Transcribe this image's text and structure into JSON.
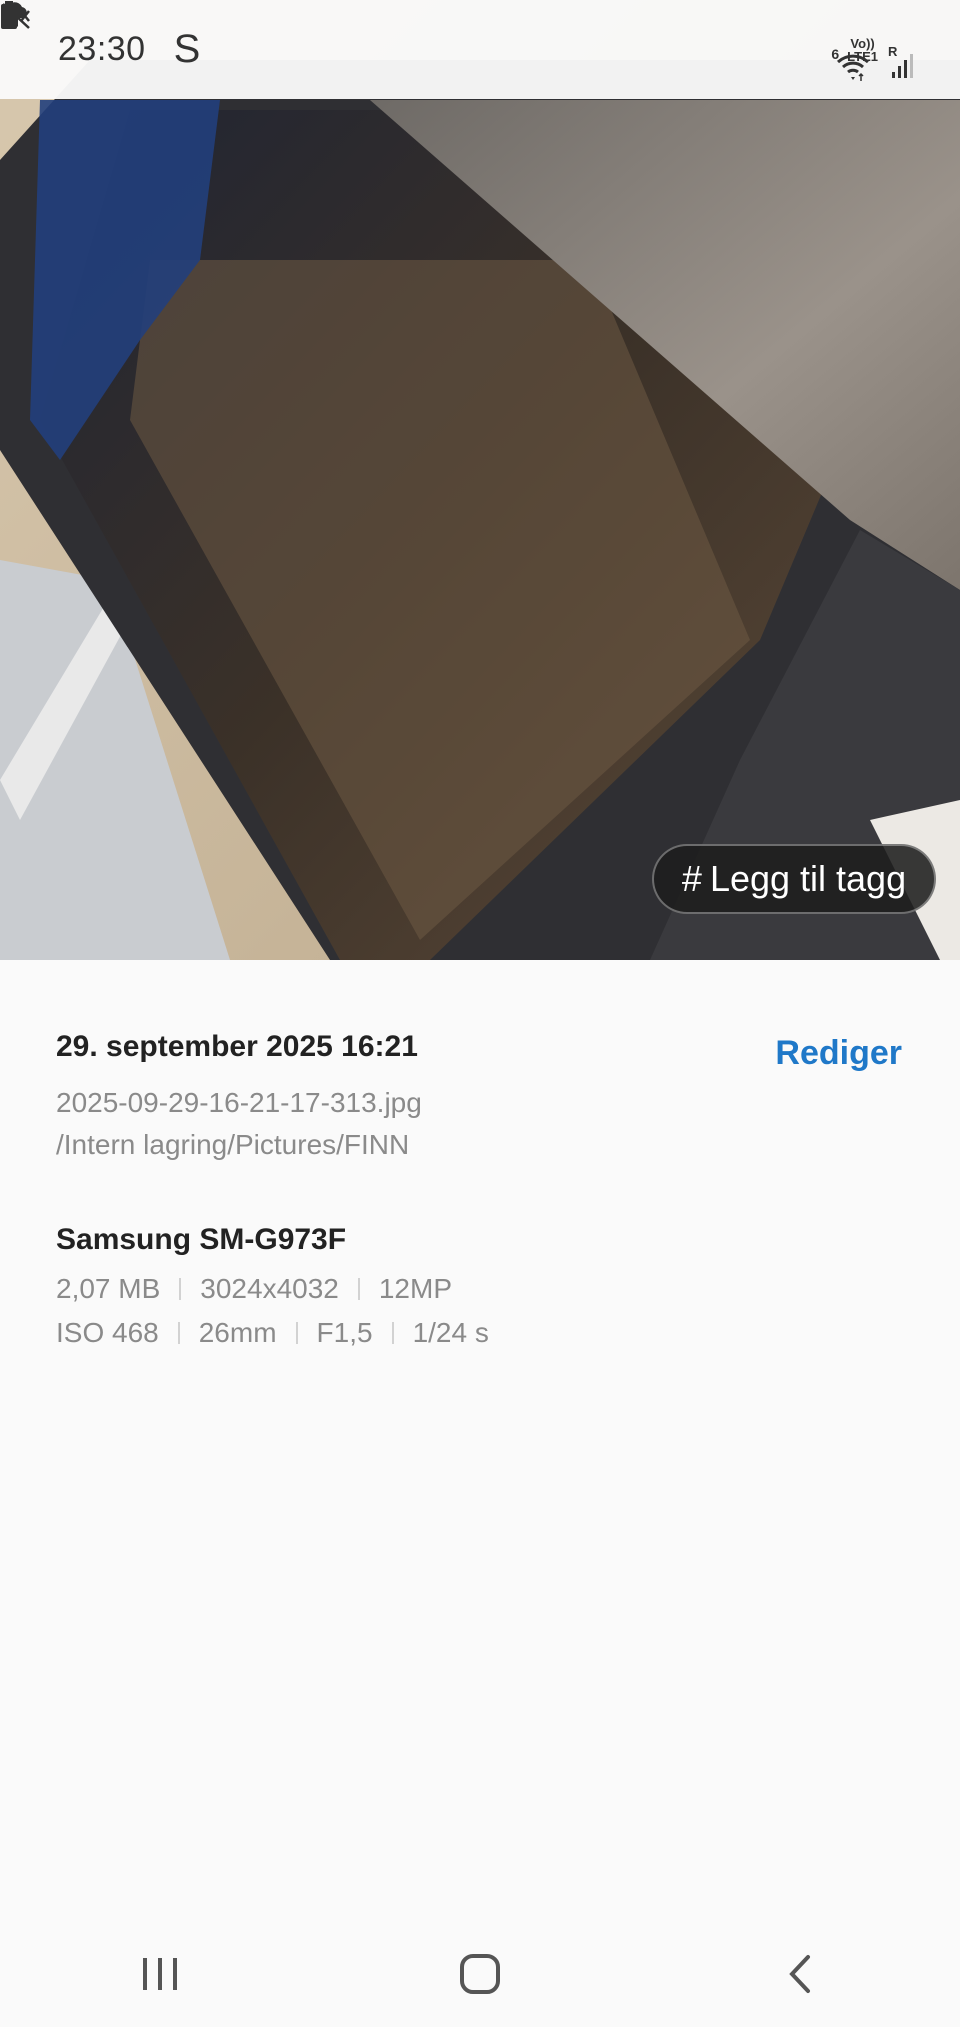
{
  "status_bar": {
    "time": "23:30",
    "app_letter": "S",
    "icons": [
      "cloud-icon",
      "mute-icon",
      "wifi-icon",
      "volte-lte-icon",
      "signal-icon",
      "battery-icon"
    ],
    "wifi_badge": "6",
    "volte_label": "Vo))",
    "lte_label": "LTE1",
    "roaming_label": "R"
  },
  "photo": {
    "tag_button": {
      "hash": "#",
      "label": "Legg til tagg"
    }
  },
  "details": {
    "date": "29. september 2025 16:21",
    "edit_label": "Rediger",
    "filename": "2025-09-29-16-21-17-313.jpg",
    "path": "/Intern lagring/Pictures/FINN",
    "device": "Samsung SM-G973F",
    "file_info": [
      "2,07 MB",
      "3024x4032",
      "12MP"
    ],
    "camera_info": [
      "ISO 468",
      "26mm",
      "F1,5",
      "1/24 s"
    ]
  },
  "nav_bar": {
    "icons": [
      "recent-apps-icon",
      "home-icon",
      "back-icon"
    ]
  },
  "colors": {
    "accent": "#1f78c8",
    "text_primary": "#222222",
    "text_secondary": "#8a8a8a",
    "background": "#fafafa"
  }
}
